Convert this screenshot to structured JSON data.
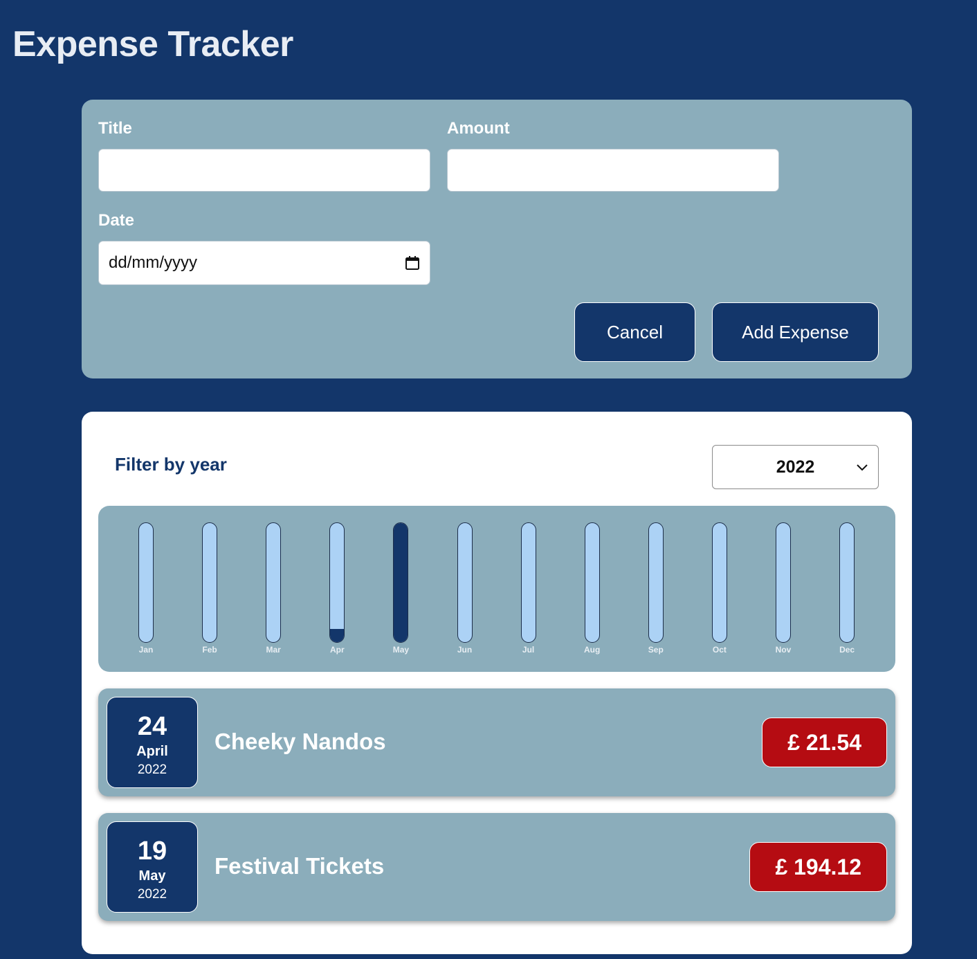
{
  "header": {
    "title": "Expense Tracker"
  },
  "form": {
    "title_label": "Title",
    "title_value": "",
    "amount_label": "Amount",
    "amount_value": "",
    "date_label": "Date",
    "date_placeholder": "dd/mm/yyyy",
    "cancel_label": "Cancel",
    "submit_label": "Add Expense"
  },
  "filter": {
    "label": "Filter by year",
    "selected_year": "2022"
  },
  "colors": {
    "background": "#13366a",
    "panel": "#8badbb",
    "bar_empty": "#acd2f5",
    "bar_fill": "#13366a",
    "price_badge": "#b50c12"
  },
  "chart_data": {
    "type": "bar",
    "categories": [
      "Jan",
      "Feb",
      "Mar",
      "Apr",
      "May",
      "Jun",
      "Jul",
      "Aug",
      "Sep",
      "Oct",
      "Nov",
      "Dec"
    ],
    "values": [
      0,
      0,
      0,
      21.54,
      194.12,
      0,
      0,
      0,
      0,
      0,
      0,
      0
    ],
    "ylim": [
      0,
      194.12
    ],
    "grid": false
  },
  "expenses": [
    {
      "day": "24",
      "month": "April",
      "year": "2022",
      "title": "Cheeky Nandos",
      "amount": "£ 21.54"
    },
    {
      "day": "19",
      "month": "May",
      "year": "2022",
      "title": "Festival Tickets",
      "amount": "£ 194.12"
    }
  ]
}
